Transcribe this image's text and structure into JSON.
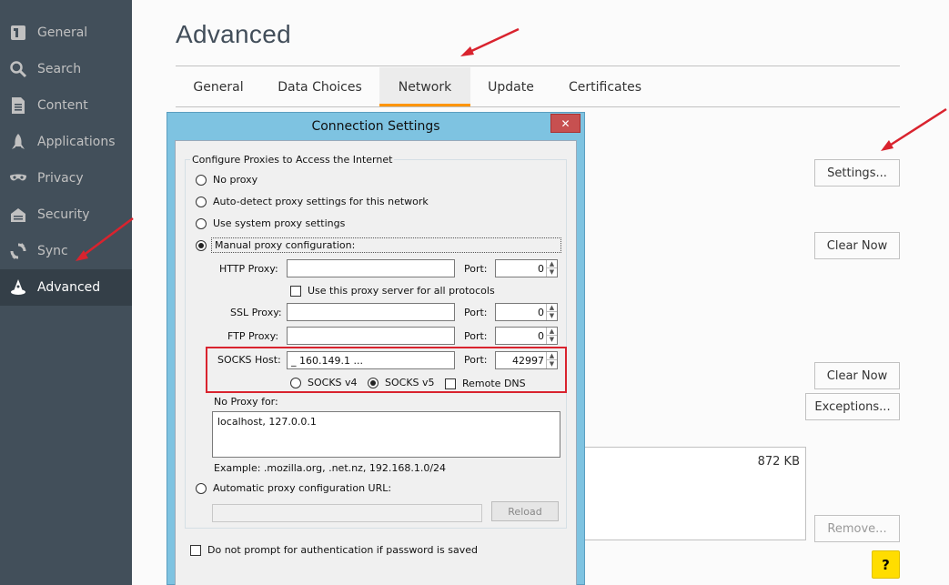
{
  "sidebar": {
    "items": [
      {
        "label": "General",
        "icon": "general-icon",
        "active": false
      },
      {
        "label": "Search",
        "icon": "search-icon",
        "active": false
      },
      {
        "label": "Content",
        "icon": "content-icon",
        "active": false
      },
      {
        "label": "Applications",
        "icon": "applications-icon",
        "active": false
      },
      {
        "label": "Privacy",
        "icon": "privacy-mask-icon",
        "active": false
      },
      {
        "label": "Security",
        "icon": "security-lock-icon",
        "active": false
      },
      {
        "label": "Sync",
        "icon": "sync-icon",
        "active": false
      },
      {
        "label": "Advanced",
        "icon": "advanced-wizard-hat-icon",
        "active": true
      }
    ]
  },
  "main": {
    "title": "Advanced",
    "tabs": [
      {
        "label": "General"
      },
      {
        "label": "Data Choices"
      },
      {
        "label": "Network"
      },
      {
        "label": "Update"
      },
      {
        "label": "Certificates"
      }
    ],
    "selected_tab": "Network",
    "buttons": {
      "settings": "Settings...",
      "clear_now_1": "Clear Now",
      "clear_now_2": "Clear Now",
      "exceptions": "Exceptions...",
      "remove": "Remove..."
    },
    "cache_size": "872 KB",
    "help": "?"
  },
  "dialog": {
    "title": "Connection Settings",
    "close": "✕",
    "group_label": "Configure Proxies to Access the Internet",
    "options": {
      "no_proxy": "No proxy",
      "auto_detect": "Auto-detect proxy settings for this network",
      "system": "Use system proxy settings",
      "manual": "Manual proxy configuration:",
      "auto_url": "Automatic proxy configuration URL:"
    },
    "selected_option": "manual",
    "http_proxy": {
      "label": "HTTP Proxy:",
      "value": "",
      "port_label": "Port:",
      "port": "0"
    },
    "use_for_all": "Use this proxy server for all protocols",
    "ssl_proxy": {
      "label": "SSL Proxy:",
      "value": "",
      "port_label": "Port:",
      "port": "0"
    },
    "ftp_proxy": {
      "label": "FTP Proxy:",
      "value": "",
      "port_label": "Port:",
      "port": "0"
    },
    "socks_host": {
      "label": "SOCKS Host:",
      "value": "_   1⁠60.149.1 ...",
      "port_label": "Port:",
      "port": "42997"
    },
    "socks_v4": "SOCKS v4",
    "socks_v5": "SOCKS v5",
    "socks_version": "v5",
    "remote_dns": "Remote DNS",
    "no_proxy_for_label": "No Proxy for:",
    "no_proxy_for_value": "localhost, 127.0.0.1",
    "example": "Example: .mozilla.org, .net.nz, 192.168.1.0/24",
    "auto_url_value": "",
    "reload": "Reload",
    "no_prompt": "Do not prompt for authentication if password is saved"
  },
  "colors": {
    "sidebar_bg": "#424f5a",
    "sidebar_active": "#343f48",
    "tab_accent": "#ff9500",
    "dialog_frame": "#7ec3e1",
    "highlight_box": "#d9232e",
    "annotation_arrow": "#d9232e",
    "help_button": "#ffdd00"
  }
}
